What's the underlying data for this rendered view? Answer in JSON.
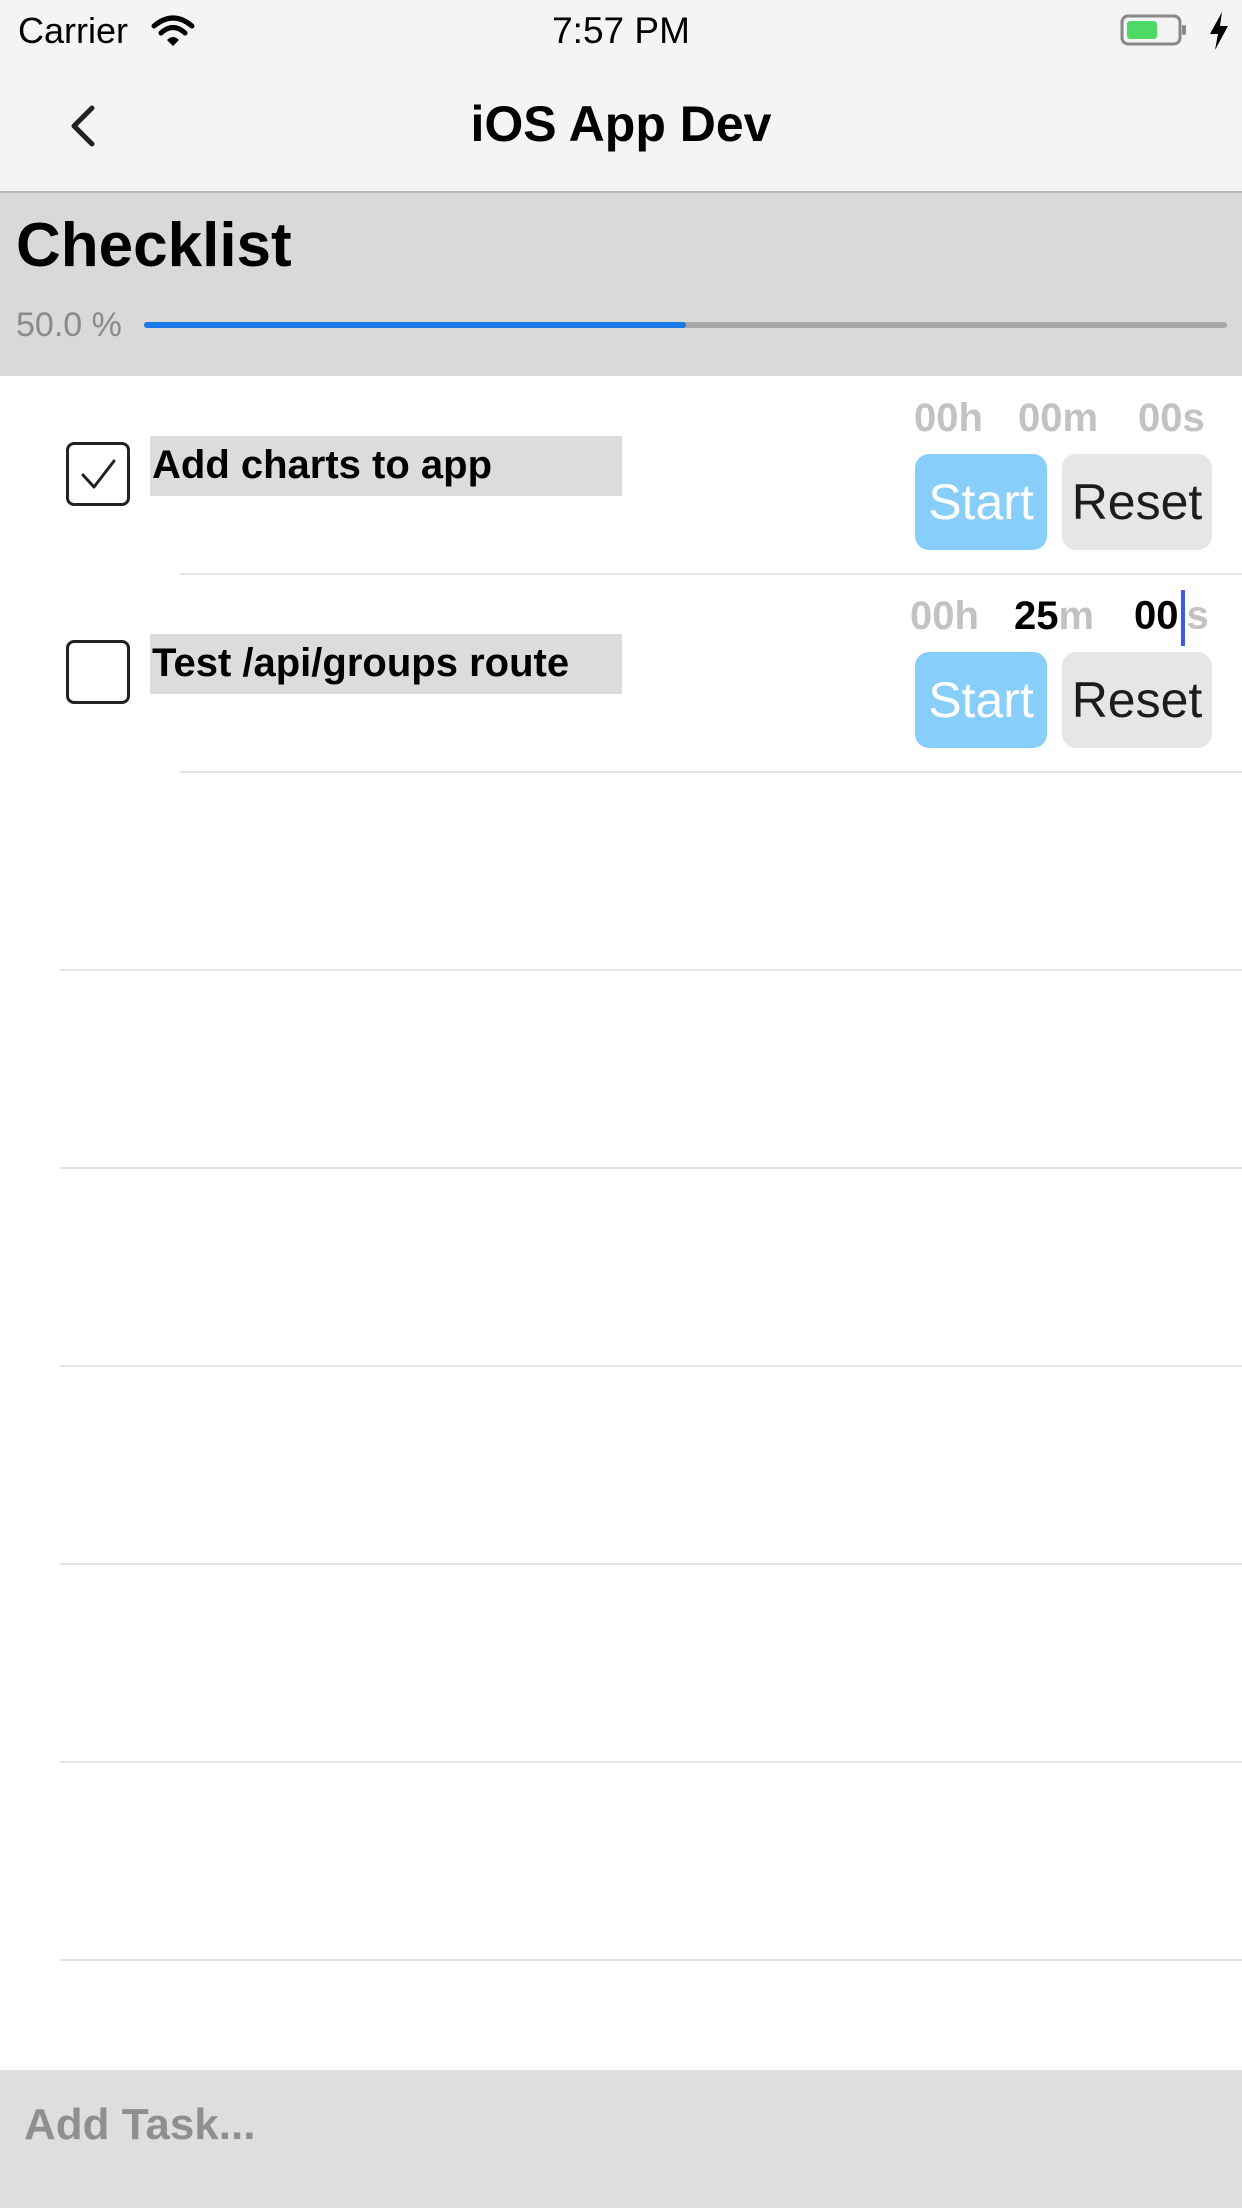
{
  "status_bar": {
    "carrier": "Carrier",
    "time": "7:57 PM"
  },
  "nav": {
    "title": "iOS App Dev"
  },
  "checklist": {
    "title": "Checklist",
    "progress_label": "50.0 %",
    "progress_fraction": 0.5
  },
  "tasks": [
    {
      "label": "Add charts to app",
      "checked": true,
      "hours": "00h",
      "minutes": "00m",
      "seconds": "00s",
      "start_label": "Start",
      "reset_label": "Reset"
    },
    {
      "label": "Test /api/groups route",
      "checked": false,
      "hours": "00h",
      "minutes_value": "25",
      "minutes_unit": "m",
      "seconds_value": "00",
      "seconds_unit": "s",
      "start_label": "Start",
      "reset_label": "Reset"
    }
  ],
  "add_task": {
    "placeholder": "Add Task..."
  },
  "colors": {
    "progress_fill": "#1a7ae8",
    "start_button": "#87cefa",
    "reset_button": "#e6e6e6",
    "header_panel": "#d9d9d9"
  },
  "icons": [
    "wifi-icon",
    "battery-icon",
    "charging-bolt-icon",
    "back-chevron-icon",
    "checkmark-icon"
  ]
}
